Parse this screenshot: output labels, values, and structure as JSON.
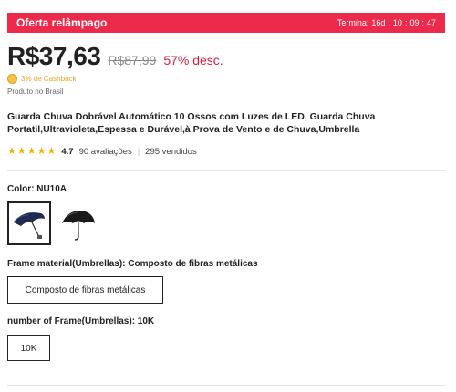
{
  "banner": {
    "title": "Oferta relâmpago",
    "timer_label": "Termina:",
    "timer": {
      "days": "16d",
      "hours": "10",
      "minutes": "09",
      "seconds": "47"
    }
  },
  "price": {
    "current": "R$37,63",
    "original": "R$87,99",
    "discount": "57% desc."
  },
  "cashback": "3% de Cashback",
  "origin": "Produto no Brasil",
  "product_title": "Guarda Chuva Dobrável Automático 10 Ossos com Luzes de LED, Guarda Chuva Portatil,Ultravioleta,Espessa e Durável,à Prova de Vento e de Chuva,Umbrella",
  "rating": {
    "stars": 4.7,
    "value": "4.7",
    "reviews": "90 avaliações",
    "sold": "295 vendidos"
  },
  "color": {
    "label": "Color: NU10A",
    "options": [
      {
        "name": "NU10A",
        "color": "#1f2a4f",
        "selected": true
      },
      {
        "name": "black",
        "color": "#1a1a1a",
        "selected": false
      }
    ]
  },
  "frame_material": {
    "label": "Frame material(Umbrellas): Composto de fibras metálicas",
    "option": "Composto de fibras metálicas"
  },
  "frame_number": {
    "label": "number of Frame(Umbrellas): 10K",
    "option": "10K"
  },
  "colors": {
    "accent": "#ee2a4c",
    "discount": "#d81e3f",
    "star": "#f2b100",
    "cashback": "#e8a22a"
  }
}
